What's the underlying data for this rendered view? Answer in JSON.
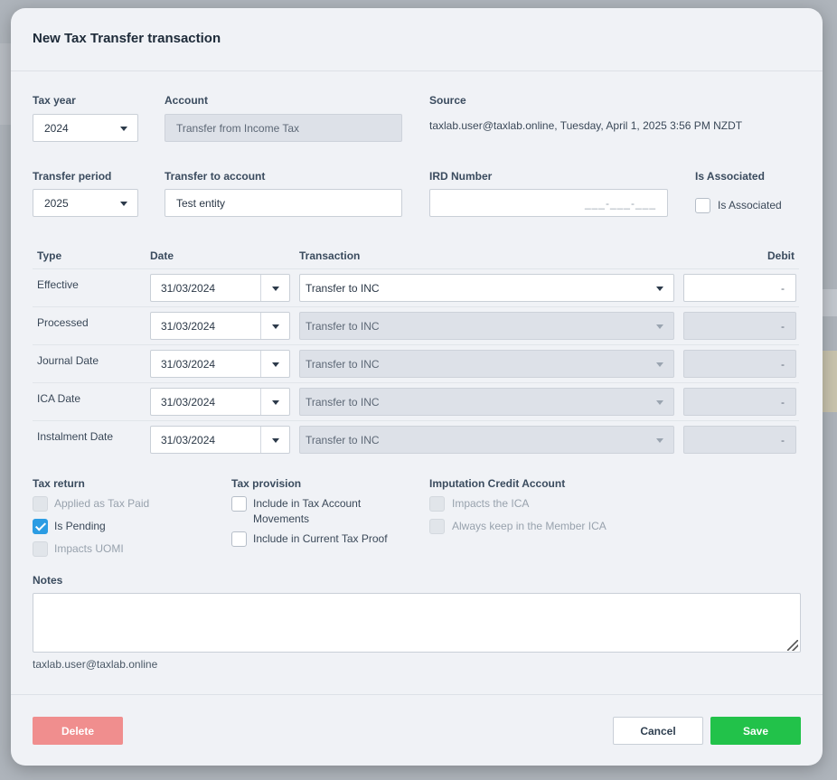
{
  "modal": {
    "title": "New Tax Transfer transaction",
    "tax_year": {
      "label": "Tax year",
      "value": "2024"
    },
    "account": {
      "label": "Account",
      "value": "Transfer from Income Tax"
    },
    "source": {
      "label": "Source",
      "value": "taxlab.user@taxlab.online, Tuesday, April 1, 2025 3:56 PM NZDT"
    },
    "transfer_period": {
      "label": "Transfer period",
      "value": "2025"
    },
    "transfer_to_account": {
      "label": "Transfer to account",
      "value": "Test entity"
    },
    "ird_number": {
      "label": "IRD Number",
      "placeholder": "___-___-___"
    },
    "is_associated": {
      "label": "Is Associated",
      "checkbox_label": "Is Associated",
      "checked": false
    },
    "table": {
      "headers": {
        "type": "Type",
        "date": "Date",
        "transaction": "Transaction",
        "debit": "Debit"
      },
      "rows": [
        {
          "type": "Effective",
          "date": "31/03/2024",
          "transaction": "Transfer to INC",
          "debit": "-"
        },
        {
          "type": "Processed",
          "date": "31/03/2024",
          "transaction": "Transfer to INC",
          "debit": "-"
        },
        {
          "type": "Journal Date",
          "date": "31/03/2024",
          "transaction": "Transfer to INC",
          "debit": "-"
        },
        {
          "type": "ICA Date",
          "date": "31/03/2024",
          "transaction": "Transfer to INC",
          "debit": "-"
        },
        {
          "type": "Instalment Date",
          "date": "31/03/2024",
          "transaction": "Transfer to INC",
          "debit": "-"
        }
      ]
    },
    "tax_return": {
      "label": "Tax return",
      "applied_as_tax_paid": "Applied as Tax Paid",
      "is_pending": "Is Pending",
      "impacts_uomi": "Impacts UOMI"
    },
    "tax_provision": {
      "label": "Tax provision",
      "include_tax_account_movements_line1": "Include in Tax Account",
      "include_tax_account_movements_line2": "Movements",
      "include_current_tax_proof": "Include in Current Tax Proof"
    },
    "ica": {
      "label": "Imputation Credit Account",
      "impacts_ica": "Impacts the ICA",
      "always_keep": "Always keep in the Member ICA"
    },
    "notes": {
      "label": "Notes",
      "value": ""
    },
    "author": "taxlab.user@taxlab.online",
    "buttons": {
      "delete": "Delete",
      "cancel": "Cancel",
      "save": "Save"
    }
  },
  "colors": {
    "save": "#22c24a",
    "delete": "#f08e8e",
    "checkbox_checked": "#2b9ce3",
    "modal_bg": "#f0f2f6"
  }
}
